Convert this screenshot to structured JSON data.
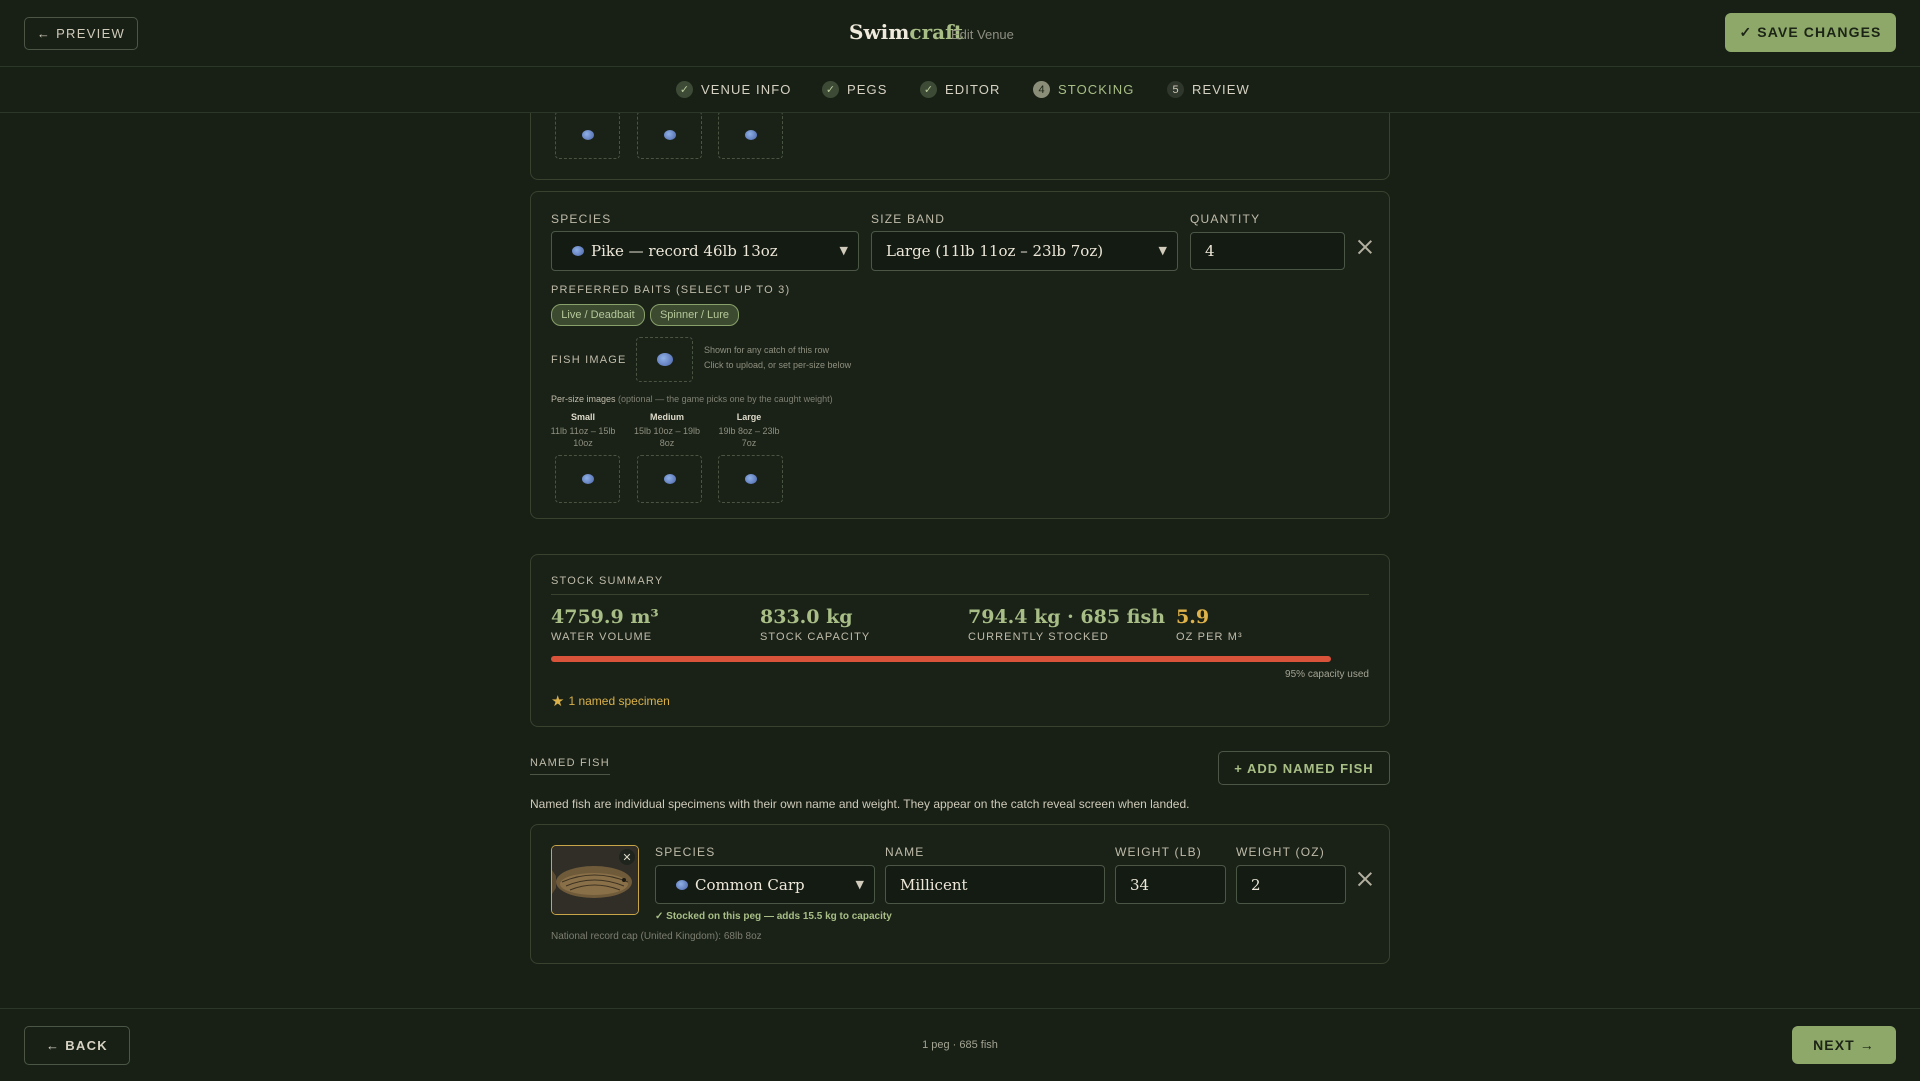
{
  "header": {
    "preview_label": "← PREVIEW",
    "brand_first": "Swim",
    "brand_second": "craft",
    "subtitle": "Edit Venue",
    "save_label": "✓ SAVE CHANGES"
  },
  "steps": [
    {
      "num": "✓",
      "label": "VENUE INFO"
    },
    {
      "num": "✓",
      "label": "PEGS"
    },
    {
      "num": "✓",
      "label": "EDITOR"
    },
    {
      "num": "4",
      "label": "STOCKING"
    },
    {
      "num": "5",
      "label": "REVIEW"
    }
  ],
  "stock_row": {
    "species_label": "SPECIES",
    "species_value": "Pike — record 46lb 13oz",
    "size_label": "SIZE BAND",
    "size_value": "Large (11lb 11oz – 23lb 7oz)",
    "quantity_label": "QUANTITY",
    "quantity_value": "4",
    "baits_label": "PREFERRED BAITS (SELECT UP TO 3)",
    "baits": [
      "Live / Deadbait",
      "Spinner / Lure"
    ],
    "fish_image_label": "FISH IMAGE",
    "fish_image_hint_1": "Shown for any catch of this row",
    "fish_image_hint_2": "Click to upload, or set per-size below",
    "per_size_title": "Per-size images",
    "per_size_note": "(optional — the game picks one by the caught weight)",
    "sizes": [
      {
        "name": "Small",
        "range_1": "11lb 11oz – 15lb",
        "range_2": "10oz"
      },
      {
        "name": "Medium",
        "range_1": "15lb 10oz – 19lb",
        "range_2": "8oz"
      },
      {
        "name": "Large",
        "range_1": "19lb 8oz – 23lb",
        "range_2": "7oz"
      }
    ]
  },
  "summary": {
    "title": "STOCK SUMMARY",
    "stats": [
      {
        "value": "4759.9 m³",
        "label": "WATER VOLUME",
        "color": "#a8be86"
      },
      {
        "value": "833.0 kg",
        "label": "STOCK CAPACITY",
        "color": "#a8be86"
      },
      {
        "value": "794.4 kg · 685 fish",
        "label": "CURRENTLY STOCKED",
        "color": "#a8be86"
      },
      {
        "value": "5.9",
        "label": "OZ PER M³",
        "color": "#e0b24a"
      }
    ],
    "capacity_fraction": 0.954,
    "bar_color": "#d9533a",
    "capacity_text": "95% capacity used",
    "named_text": "1 named specimen"
  },
  "named": {
    "title": "NAMED FISH",
    "add_label": "+ ADD NAMED FISH",
    "description": "Named fish are individual specimens with their own name and weight. They appear on the catch reveal screen when landed.",
    "species_label": "SPECIES",
    "species_value": "Common Carp",
    "name_label": "NAME",
    "name_value": "Millicent",
    "weight_lb_label": "WEIGHT (LB)",
    "weight_lb_value": "34",
    "weight_oz_label": "WEIGHT (OZ)",
    "weight_oz_value": "2",
    "stocked_note": "✓ Stocked on this peg — adds 15.5 kg to capacity",
    "record_note": "National record cap (United Kingdom): 68lb 8oz"
  },
  "footer": {
    "back_label": "← BACK",
    "status": "1 peg · 685 fish",
    "next_label": "NEXT →"
  },
  "colors": {
    "accent": "#a8be86",
    "button_green": "#8ea86a",
    "background": "#182016"
  }
}
